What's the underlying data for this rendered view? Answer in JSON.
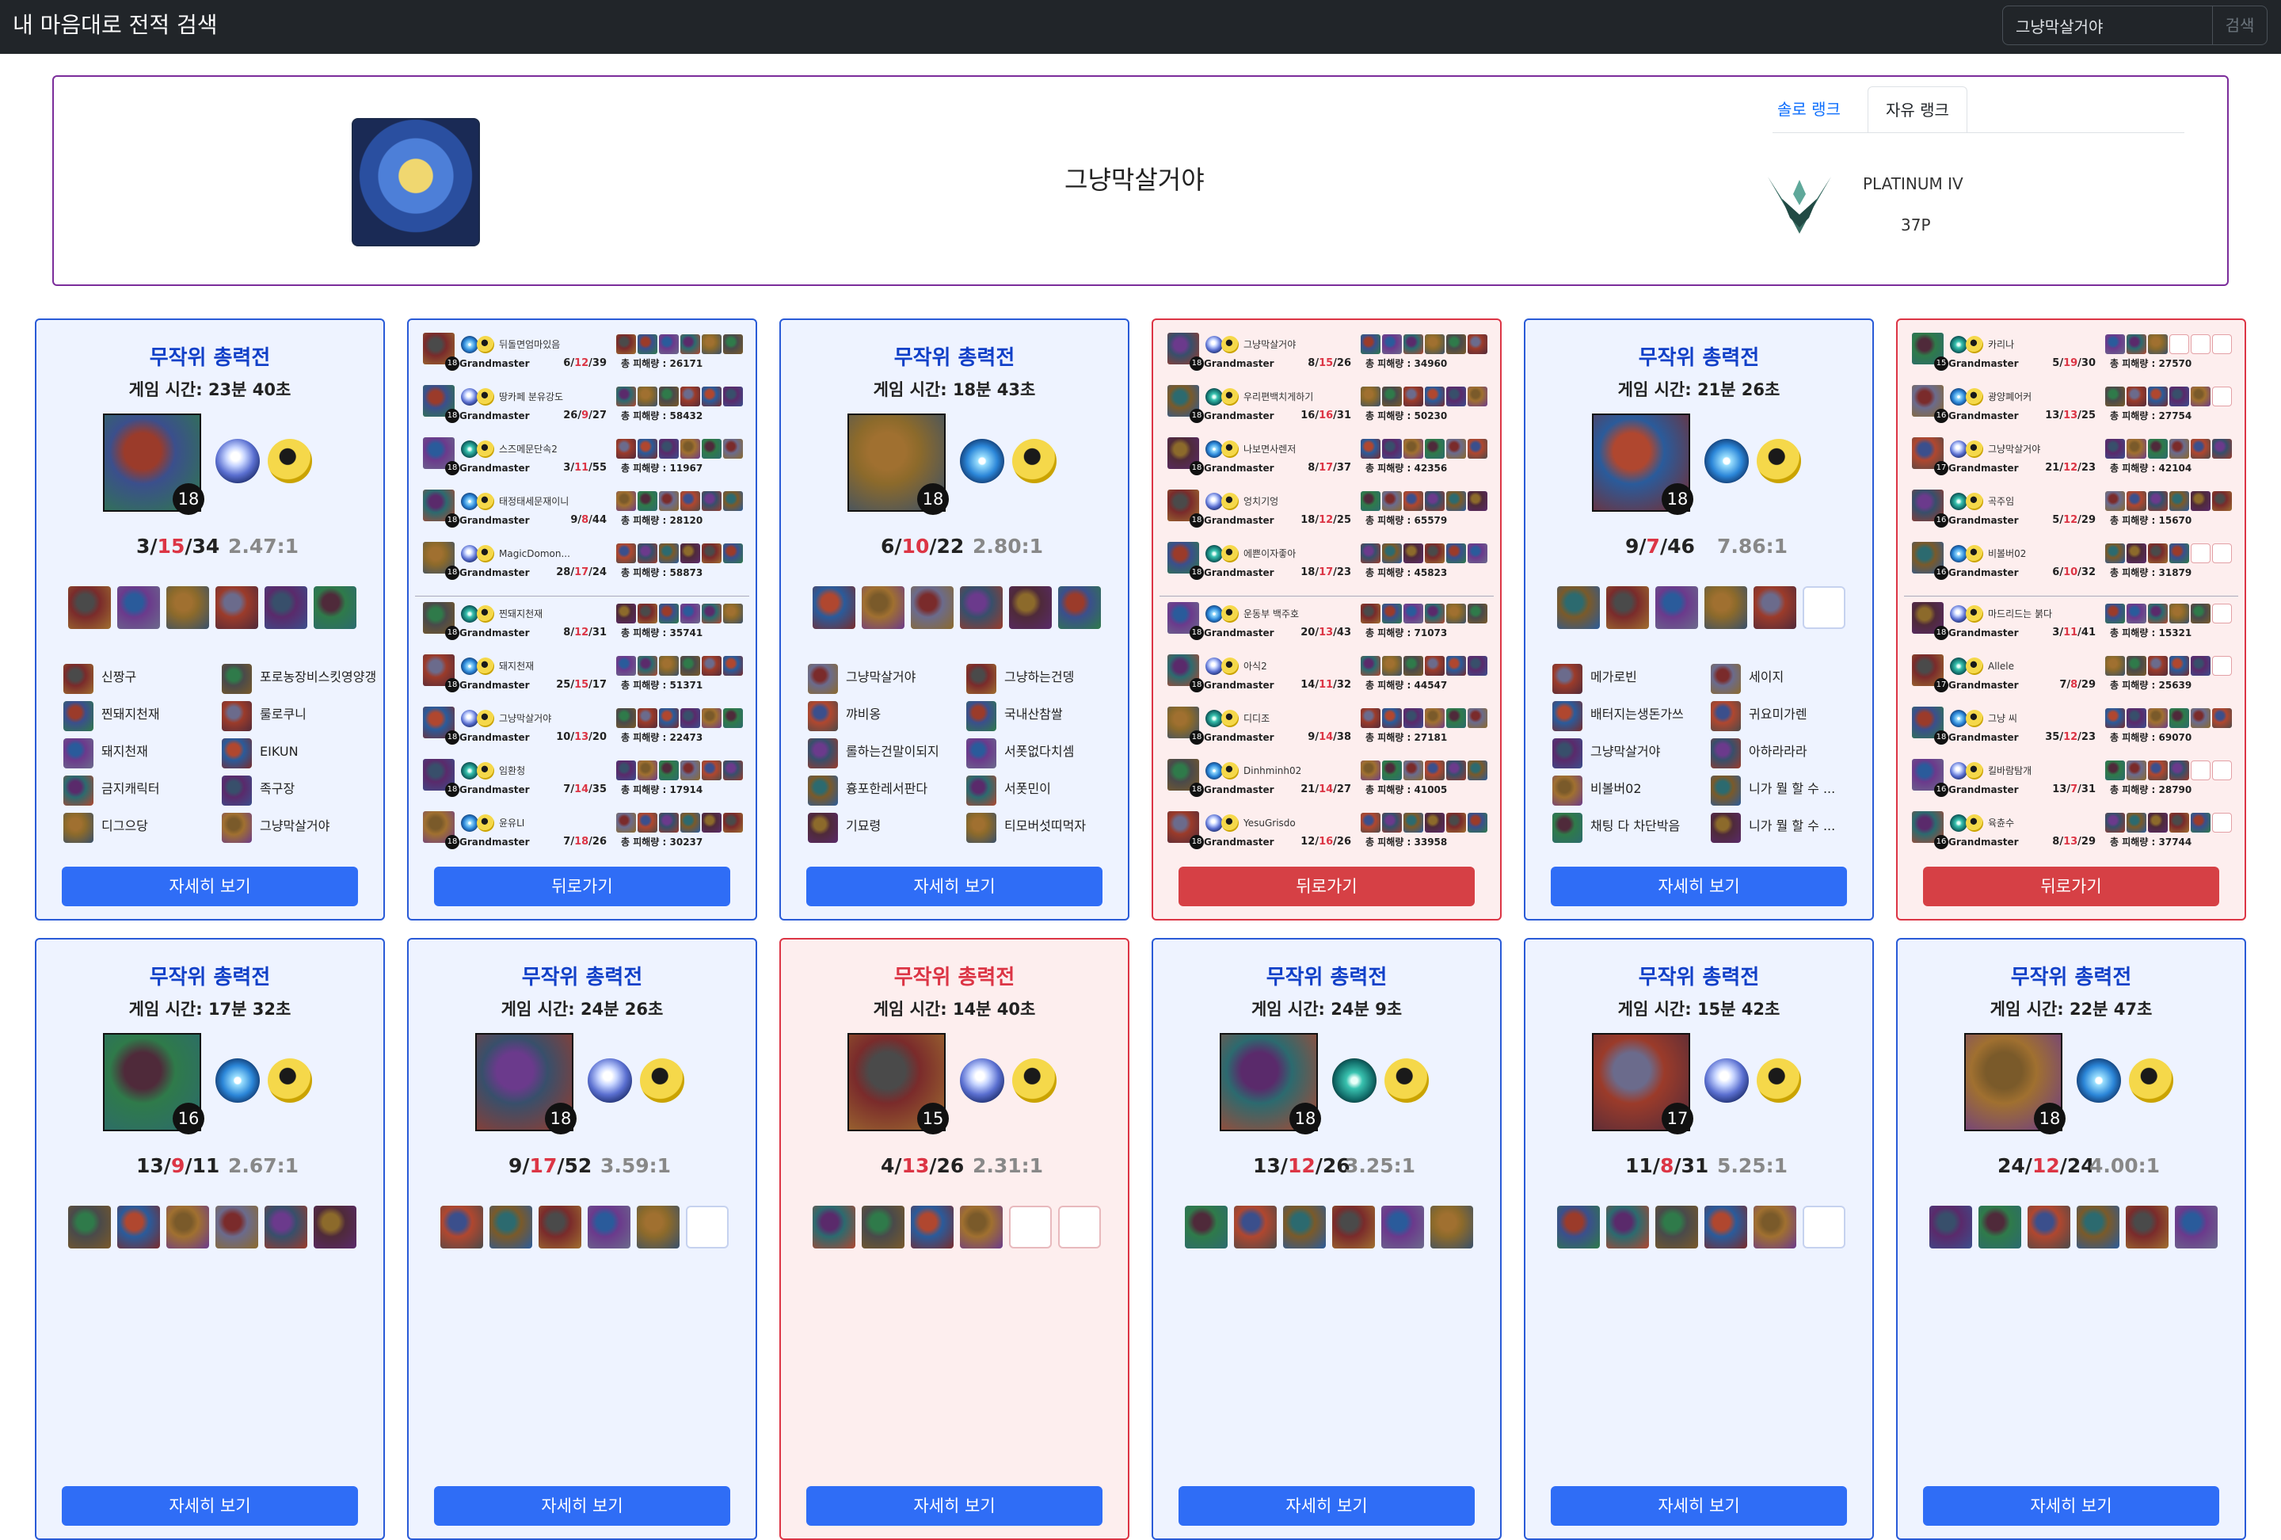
{
  "app": {
    "title": "내 마음대로 전적 검색"
  },
  "search": {
    "value": "그냥막살거야",
    "button": "검색"
  },
  "profile": {
    "name": "그냥막살거야",
    "tabs": [
      "솔로 랭크",
      "자유 랭크"
    ],
    "tier": "PLATINUM IV",
    "lp": "37P"
  },
  "labels": {
    "detail": "자세히 보기",
    "back": "뒤로가기",
    "grandmaster": "Grandmaster",
    "dmg": "총 피해량 : "
  },
  "colors": {
    "win_border": "#2a5bd7",
    "lose_border": "#dc3545",
    "button_blue": "#2f6df6",
    "button_red": "#d64045"
  },
  "summaries": [
    {
      "title": "무작위 총력전",
      "time": "게임 시간: 23분 40초",
      "result": "win",
      "level": "18",
      "k": "3",
      "d": "15",
      "a": "34",
      "ratio": "2.47:1",
      "spell1": "clarity",
      "spell2": "mark",
      "players": [
        "신짱구",
        "찐돼지천재",
        "돼지천재",
        "금지캐릭터",
        "디그으당",
        "포로농장비스킷영양갱",
        "룰로쿠니",
        "EIKUN",
        "족구장",
        "그냥막살거야"
      ],
      "empty_slots": 0
    },
    {
      "title": "무작위 총력전",
      "time": "게임 시간: 18분 43초",
      "result": "win",
      "level": "18",
      "k": "6",
      "d": "10",
      "a": "22",
      "ratio": "2.80:1",
      "spell1": "flash",
      "spell2": "mark",
      "players": [
        "그냥막살거야",
        "꺄비옹",
        "롤하는건말이되지",
        "흉포한레서판다",
        "기묘령",
        "그냥하는건뎅",
        "국내산참쌀",
        "서폿없다치셈",
        "서폿민이",
        "티모버섯띠먹자"
      ],
      "empty_slots": 0
    },
    {
      "title": "무작위 총력전",
      "time": "게임 시간: 21분 26초",
      "result": "win",
      "level": "18",
      "k": "9",
      "d": "7",
      "a": "46",
      "ratio": "7.86:1",
      "spell1": "flash",
      "spell2": "mark",
      "players": [
        "메가로빈",
        "배터지는생돈가쓰",
        "그냥막살거야",
        "비볼버02",
        "채팅 다 차단박음",
        "세이지",
        "귀요미가렌",
        "아하라라라",
        "니가 뭘 할 수 ...",
        "니가 뭘 할 수 ..."
      ],
      "empty_slots": 1
    },
    {
      "title": "무작위 총력전",
      "time": "게임 시간: 17분 32초",
      "result": "win",
      "level": "16",
      "k": "13",
      "d": "9",
      "a": "11",
      "ratio": "2.67:1",
      "spell1": "flash",
      "spell2": "mark",
      "players": [],
      "empty_slots": 0
    },
    {
      "title": "무작위 총력전",
      "time": "게임 시간: 24분 26초",
      "result": "win",
      "level": "18",
      "k": "9",
      "d": "17",
      "a": "52",
      "ratio": "3.59:1",
      "spell1": "clarity",
      "spell2": "mark",
      "players": [],
      "empty_slots": 1
    },
    {
      "title": "무작위 총력전",
      "time": "게임 시간: 14분 40초",
      "result": "lose",
      "level": "15",
      "k": "4",
      "d": "13",
      "a": "26",
      "ratio": "2.31:1",
      "spell1": "clarity",
      "spell2": "mark",
      "players": [],
      "empty_slots": 2
    },
    {
      "title": "무작위 총력전",
      "time": "게임 시간: 24분 9초",
      "result": "win",
      "level": "18",
      "k": "13",
      "d": "12",
      "a": "26",
      "ratio": "3.25:1",
      "spell1": "ghost",
      "spell2": "mark",
      "players": [],
      "empty_slots": 0
    },
    {
      "title": "무작위 총력전",
      "time": "게임 시간: 15분 42초",
      "result": "win",
      "level": "17",
      "k": "11",
      "d": "8",
      "a": "31",
      "ratio": "5.25:1",
      "spell1": "clarity",
      "spell2": "mark",
      "players": [],
      "empty_slots": 1
    },
    {
      "title": "무작위 총력전",
      "time": "게임 시간: 22분 47초",
      "result": "win",
      "level": "18",
      "k": "24",
      "d": "12",
      "a": "24",
      "ratio": "4.00:1",
      "spell1": "flash",
      "spell2": "mark",
      "players": [],
      "empty_slots": 0
    }
  ],
  "details": [
    {
      "result": "win",
      "rows": [
        {
          "name": "뒤돌면엄마있음",
          "lv": "18",
          "k": "6",
          "d": "12",
          "a": "39",
          "dmg": "26171",
          "empty": 0
        },
        {
          "name": "땅카페 분유강도",
          "lv": "18",
          "k": "26",
          "d": "9",
          "a": "27",
          "dmg": "58432",
          "empty": 0
        },
        {
          "name": "스즈메문단속2",
          "lv": "18",
          "k": "3",
          "d": "11",
          "a": "55",
          "dmg": "11967",
          "empty": 0
        },
        {
          "name": "태정태세문재이니",
          "lv": "18",
          "k": "9",
          "d": "8",
          "a": "44",
          "dmg": "28120",
          "empty": 0
        },
        {
          "name": "MagicDomon...",
          "lv": "18",
          "k": "28",
          "d": "17",
          "a": "24",
          "dmg": "58873",
          "empty": 0
        },
        {
          "name": "찐돼지천재",
          "lv": "18",
          "k": "8",
          "d": "12",
          "a": "31",
          "dmg": "35741",
          "empty": 0
        },
        {
          "name": "돼지천재",
          "lv": "18",
          "k": "25",
          "d": "15",
          "a": "17",
          "dmg": "51371",
          "empty": 0
        },
        {
          "name": "그냥막살거야",
          "lv": "18",
          "k": "10",
          "d": "13",
          "a": "20",
          "dmg": "22473",
          "empty": 0
        },
        {
          "name": "임환청",
          "lv": "18",
          "k": "7",
          "d": "14",
          "a": "35",
          "dmg": "17914",
          "empty": 0
        },
        {
          "name": "윤유LI",
          "lv": "18",
          "k": "7",
          "d": "18",
          "a": "26",
          "dmg": "30237",
          "empty": 0
        }
      ]
    },
    {
      "result": "lose",
      "rows": [
        {
          "name": "그냥막살거야",
          "lv": "18",
          "k": "8",
          "d": "15",
          "a": "26",
          "dmg": "34960",
          "empty": 0
        },
        {
          "name": "우리편백치게하기",
          "lv": "18",
          "k": "16",
          "d": "16",
          "a": "31",
          "dmg": "50230",
          "empty": 0
        },
        {
          "name": "나보면사렌저",
          "lv": "18",
          "k": "8",
          "d": "17",
          "a": "37",
          "dmg": "42356",
          "empty": 0
        },
        {
          "name": "엉치기엉",
          "lv": "18",
          "k": "18",
          "d": "12",
          "a": "25",
          "dmg": "65579",
          "empty": 0
        },
        {
          "name": "에쁜이자좋아",
          "lv": "18",
          "k": "18",
          "d": "17",
          "a": "23",
          "dmg": "45823",
          "empty": 0
        },
        {
          "name": "운동부 백주호",
          "lv": "18",
          "k": "20",
          "d": "13",
          "a": "43",
          "dmg": "71073",
          "empty": 0
        },
        {
          "name": "아식2",
          "lv": "18",
          "k": "14",
          "d": "11",
          "a": "32",
          "dmg": "44547",
          "empty": 0
        },
        {
          "name": "디디조",
          "lv": "18",
          "k": "9",
          "d": "14",
          "a": "38",
          "dmg": "27181",
          "empty": 0
        },
        {
          "name": "Dinhminh02",
          "lv": "18",
          "k": "21",
          "d": "14",
          "a": "27",
          "dmg": "41005",
          "empty": 0
        },
        {
          "name": "YesuGrisdo",
          "lv": "18",
          "k": "12",
          "d": "16",
          "a": "26",
          "dmg": "33958",
          "empty": 0
        }
      ]
    },
    {
      "result": "lose",
      "rows": [
        {
          "name": "카리나",
          "lv": "15",
          "k": "5",
          "d": "19",
          "a": "30",
          "dmg": "27570",
          "empty": 3
        },
        {
          "name": "광양폐어커",
          "lv": "16",
          "k": "13",
          "d": "13",
          "a": "25",
          "dmg": "27754",
          "empty": 1
        },
        {
          "name": "그냥막살거야",
          "lv": "17",
          "k": "21",
          "d": "12",
          "a": "23",
          "dmg": "42104",
          "empty": 0
        },
        {
          "name": "곡주임",
          "lv": "16",
          "k": "5",
          "d": "12",
          "a": "29",
          "dmg": "15670",
          "empty": 0
        },
        {
          "name": "비볼버02",
          "lv": "16",
          "k": "6",
          "d": "10",
          "a": "32",
          "dmg": "31879",
          "empty": 2
        },
        {
          "name": "마드리드는 붉다",
          "lv": "18",
          "k": "3",
          "d": "11",
          "a": "41",
          "dmg": "15321",
          "empty": 1
        },
        {
          "name": "Allele",
          "lv": "17",
          "k": "7",
          "d": "8",
          "a": "29",
          "dmg": "25639",
          "empty": 1
        },
        {
          "name": "그냥 씨",
          "lv": "18",
          "k": "35",
          "d": "12",
          "a": "23",
          "dmg": "69070",
          "empty": 0
        },
        {
          "name": "킬바람탐개",
          "lv": "16",
          "k": "13",
          "d": "7",
          "a": "31",
          "dmg": "28790",
          "empty": 2
        },
        {
          "name": "육츈수",
          "lv": "16",
          "k": "8",
          "d": "13",
          "a": "29",
          "dmg": "37744",
          "empty": 1
        }
      ]
    }
  ]
}
